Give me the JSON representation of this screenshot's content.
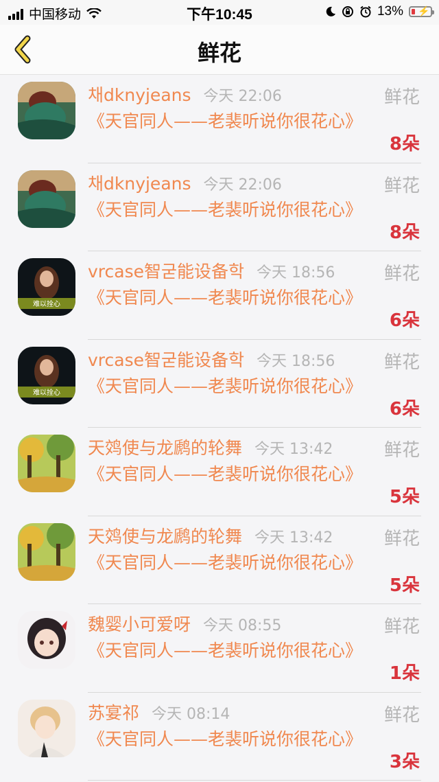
{
  "status_bar": {
    "carrier": "中国移动",
    "time": "下午10:45",
    "battery_percent": "13%"
  },
  "nav": {
    "title": "鲜花"
  },
  "items": [
    {
      "name": "채dknyjeans",
      "time": "今天 22:06",
      "category": "鲜花",
      "book": "《天官同人——老裴听说你很花心》",
      "count": "8朵",
      "avatar": "avatar-green-water"
    },
    {
      "name": "채dknyjeans",
      "time": "今天 22:06",
      "category": "鲜花",
      "book": "《天官同人——老裴听说你很花心》",
      "count": "8朵",
      "avatar": "avatar-green-water"
    },
    {
      "name": "vrcase智굳能设备학",
      "time": "今天 18:56",
      "category": "鲜花",
      "book": "《天官同人——老裴听说你很花心》",
      "count": "6朵",
      "avatar": "avatar-dark-girl"
    },
    {
      "name": "vrcase智굳能设备학",
      "time": "今天 18:56",
      "category": "鲜花",
      "book": "《天官同人——老裴听说你很花心》",
      "count": "6朵",
      "avatar": "avatar-dark-girl"
    },
    {
      "name": "天䴔使与龙䴘的轮舞",
      "time": "今天 13:42",
      "category": "鲜花",
      "book": "《天官同人——老裴听说你很花心》",
      "count": "5朵",
      "avatar": "avatar-forest"
    },
    {
      "name": "天䴔使与龙䴘的轮舞",
      "time": "今天 13:42",
      "category": "鲜花",
      "book": "《天官同人——老裴听说你很花心》",
      "count": "5朵",
      "avatar": "avatar-forest"
    },
    {
      "name": "魏婴小可爱呀",
      "time": "今天 08:55",
      "category": "鲜花",
      "book": "《天官同人——老裴听说你很花心》",
      "count": "1朵",
      "avatar": "avatar-anime-girl"
    },
    {
      "name": "苏宴祁",
      "time": "今天 08:14",
      "category": "鲜花",
      "book": "《天官同人——老裴听说你很花心》",
      "count": "3朵",
      "avatar": "avatar-anime-boy"
    }
  ],
  "avatar_label": "难以拴心",
  "colors": {
    "accent_orange": "#f0884f",
    "count_red": "#d9343c",
    "muted_gray": "#b5b5b5",
    "back_arrow": "#f2d64b"
  }
}
